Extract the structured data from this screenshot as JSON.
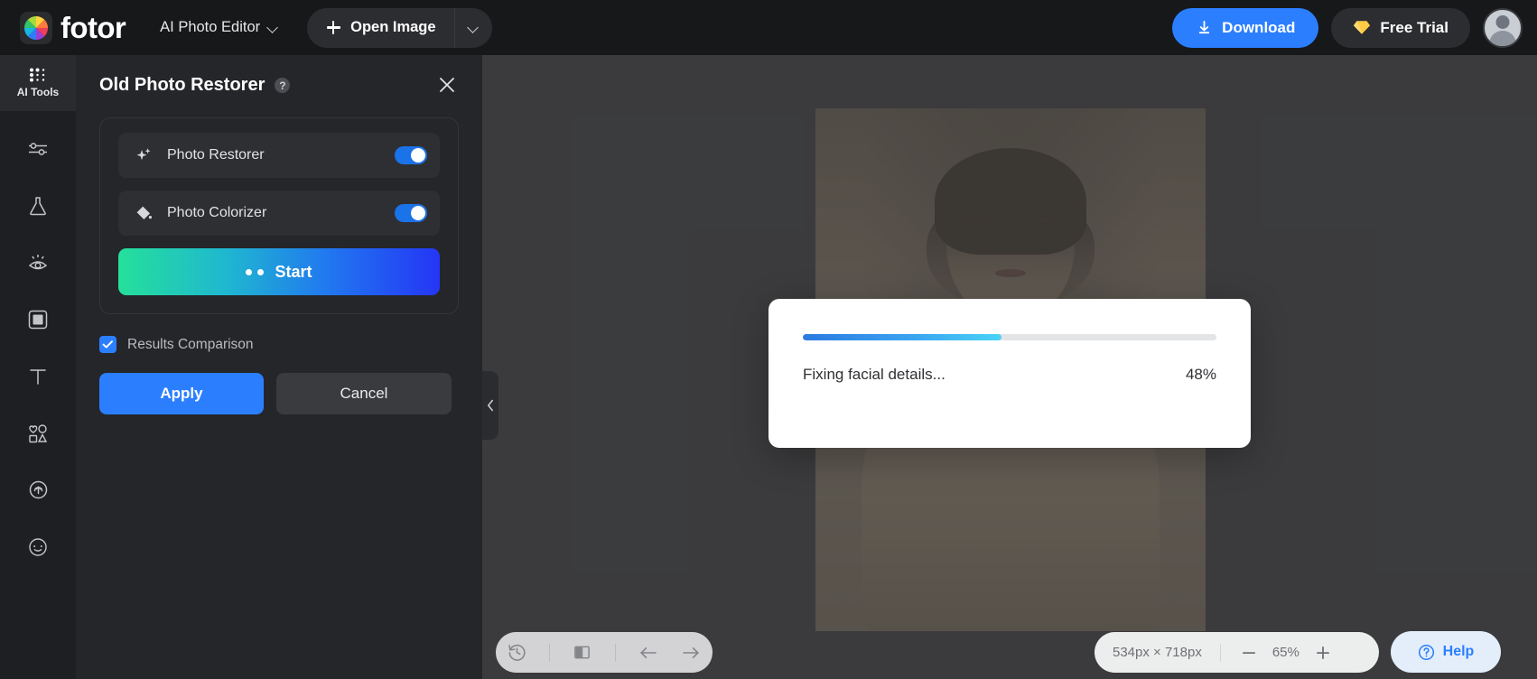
{
  "topbar": {
    "brand": "fotor",
    "brand_logo_icon": "fotor-color-wheel-logo",
    "editor_selector": {
      "label": "AI Photo Editor",
      "caret_icon": "chevron-down-icon"
    },
    "open_image": {
      "label": "Open Image",
      "plus_icon": "plus-icon",
      "caret_icon": "chevron-down-icon"
    },
    "download": {
      "label": "Download",
      "icon": "download-icon"
    },
    "free_trial": {
      "label": "Free Trial",
      "icon": "diamond-icon"
    },
    "avatar_icon": "user-avatar"
  },
  "rail": {
    "items": [
      {
        "label": "AI Tools",
        "icon": "ai-tools-grid-icon",
        "active": true
      },
      {
        "label": "",
        "icon": "adjust-sliders-icon",
        "active": false
      },
      {
        "label": "",
        "icon": "flask-effects-icon",
        "active": false
      },
      {
        "label": "",
        "icon": "retouch-eye-icon",
        "active": false
      },
      {
        "label": "",
        "icon": "frame-border-icon",
        "active": false
      },
      {
        "label": "",
        "icon": "text-icon",
        "active": false
      },
      {
        "label": "",
        "icon": "elements-shapes-icon",
        "active": false
      },
      {
        "label": "",
        "icon": "upload-cloud-icon",
        "active": false
      },
      {
        "label": "",
        "icon": "more-dots-icon",
        "active": false
      }
    ]
  },
  "panel": {
    "title": "Old Photo Restorer",
    "help_icon": "help-question-icon",
    "close_icon": "close-x-icon",
    "options": [
      {
        "label": "Photo Restorer",
        "icon": "sparkles-icon",
        "enabled": true
      },
      {
        "label": "Photo Colorizer",
        "icon": "paint-bucket-icon",
        "enabled": true
      }
    ],
    "start_button": {
      "label": "Start",
      "icon": "two-dots-icon"
    },
    "results_comparison": {
      "label": "Results Comparison",
      "checked": true,
      "check_icon": "checkmark-icon"
    },
    "apply_button": "Apply",
    "cancel_button": "Cancel",
    "collapse_handle_icon": "chevron-left-icon"
  },
  "modal": {
    "status_text": "Fixing facial details...",
    "percent_text": "48%",
    "progress_value": 48
  },
  "bottom_toolbar": {
    "items": [
      {
        "icon": "history-clock-icon"
      },
      {
        "icon": "compare-split-icon"
      },
      {
        "icon": "undo-arrow-icon"
      },
      {
        "icon": "redo-arrow-icon"
      }
    ]
  },
  "zoom_bar": {
    "dimensions": "534px × 718px",
    "zoom_level": "65%",
    "minus_icon": "minus-icon",
    "plus_icon": "plus-icon"
  },
  "help": {
    "label": "Help",
    "icon": "help-circle-icon"
  },
  "colors": {
    "accent_blue": "#2b7fff",
    "toggle_blue": "#1a73e8",
    "panel_bg": "#252629",
    "topbar_bg": "#17181a",
    "canvas_bg": "#3a3b3f"
  }
}
